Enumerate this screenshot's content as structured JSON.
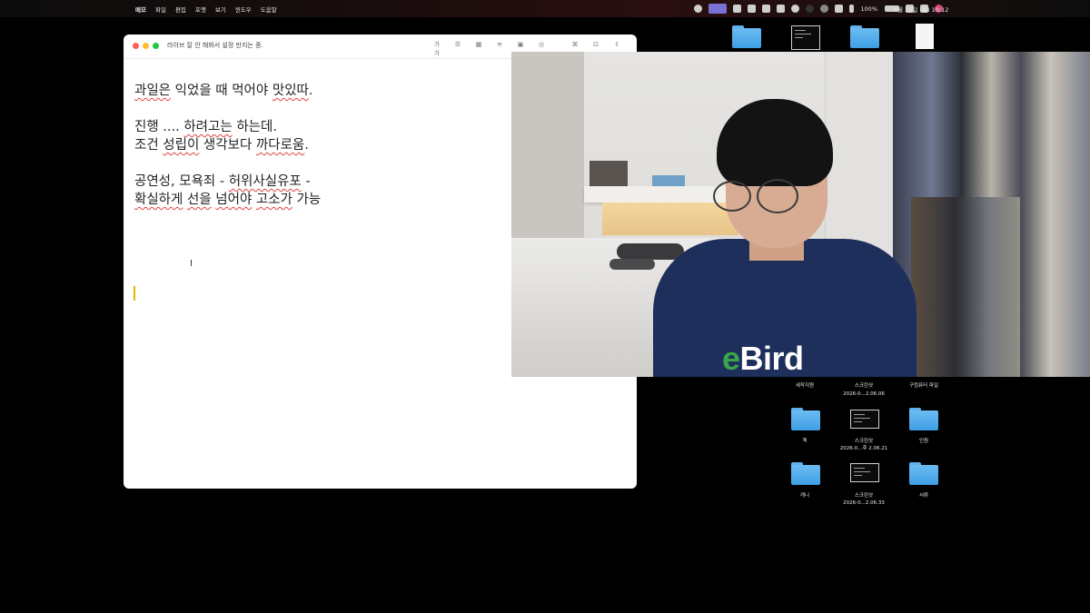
{
  "menubar": {
    "app": "메모",
    "menus": [
      "파일",
      "편집",
      "포맷",
      "보기",
      "윈도우",
      "도움말"
    ],
    "battery": "100%",
    "clock": "8월 20일 (목) 10:12"
  },
  "notes": {
    "title": "라이브 잘 안 해봐서 설정 만지는 중.",
    "toolbar_font": "가가",
    "lines": [
      "과일은 익었을 때 먹어야 맛있따.",
      "진행 .... 하려고는 하는데.",
      "조건 성립이 생각보다 까다로움.",
      "공연성, 모욕죄 - 허위사실유포 -",
      "확실하게 선을 넘어야 고소가 가능"
    ]
  },
  "webcam": {
    "shirt_text_e": "e",
    "shirt_text_rest": "Bird"
  },
  "desktop": {
    "labels": {
      "r1c1": "세작지원",
      "r1c2a": "스크린샷",
      "r1c2b": "2026-0...2.06.06",
      "r1c3": "구컴퓨터 파일",
      "r2c1": "책",
      "r2c2a": "스크린샷",
      "r2c2b": "2026-0...후 2.06.21",
      "r2c3": "인원",
      "r3c1": "캐니",
      "r3c2a": "스크린샷",
      "r3c2b": "2026-0...2.06.33",
      "r3c3": "서류"
    }
  }
}
